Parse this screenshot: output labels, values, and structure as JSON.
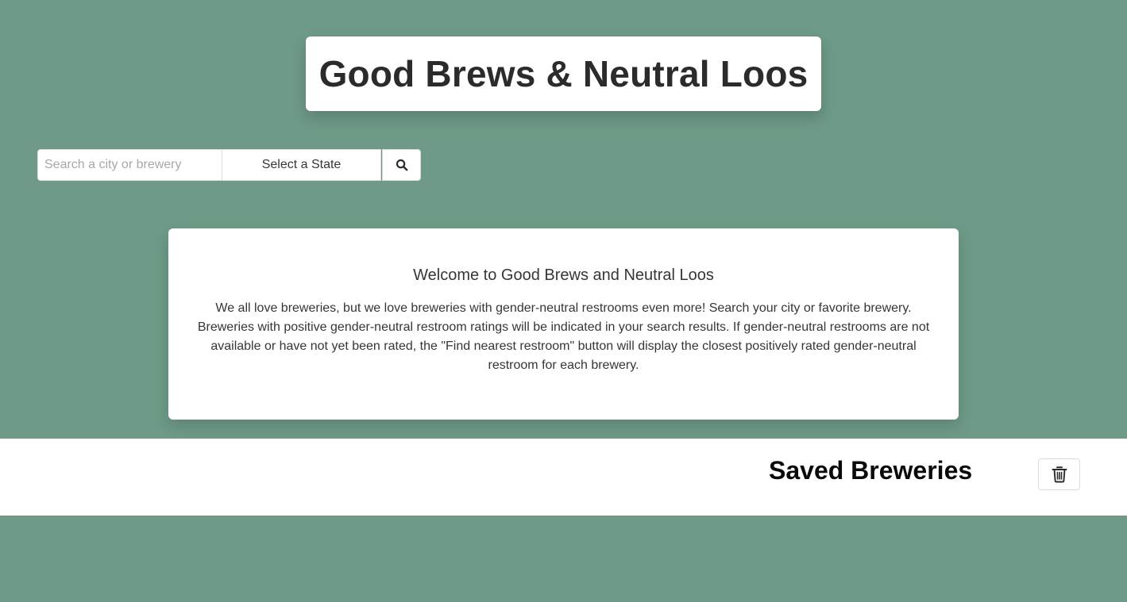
{
  "header": {
    "title": "Good Brews & Neutral Loos"
  },
  "search": {
    "placeholder": "Search a city or brewery",
    "value": "",
    "state_label": "Select a State",
    "search_icon": "search-icon"
  },
  "welcome": {
    "heading": "Welcome to Good Brews and Neutral Loos",
    "body": "We all love breweries, but we love breweries with gender-neutral restrooms even more! Search your city or favorite brewery. Breweries with positive gender-neutral restroom ratings will be indicated in your search results. If gender-neutral restrooms are not available or have not yet been rated, the \"Find nearest restroom\" button will display the closest positively rated gender-neutral restroom for each brewery."
  },
  "saved": {
    "title": "Saved Breweries",
    "clear_icon": "trash-icon"
  },
  "colors": {
    "background": "#6e9a87",
    "card": "#ffffff",
    "text": "#363636"
  }
}
